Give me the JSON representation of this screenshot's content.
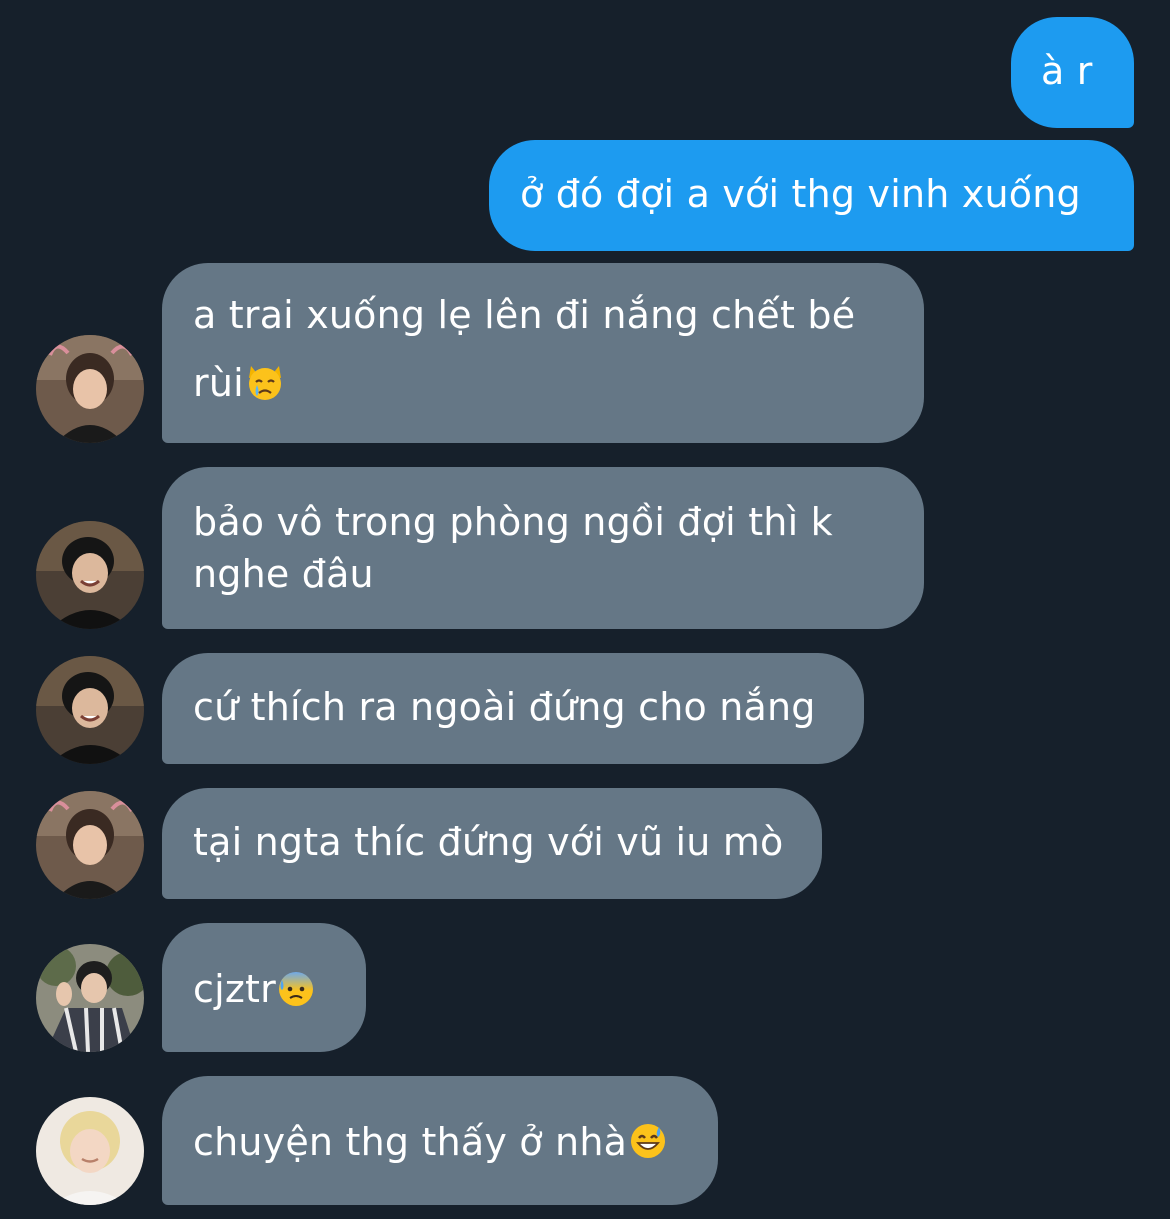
{
  "messages": [
    {
      "text": "à r"
    },
    {
      "text": "ở đó đợi a với thg vinh xuống"
    },
    {
      "line1": "a trai xuống lẹ lên đi nắng chết bé",
      "line2": "rùi",
      "emoji": "crying-cat-emoji"
    },
    {
      "line1": "bảo vô trong phòng ngồi đợi thì k",
      "line2": "nghe đâu"
    },
    {
      "text": "cứ thích ra ngoài đứng cho nắng"
    },
    {
      "text": "tại ngta thíc đứng với vũ iu mò"
    },
    {
      "text": "cjztr",
      "emoji": "anxious-face-with-sweat-emoji"
    },
    {
      "text": "chuyện thg thấy ở nhà",
      "emoji": "grinning-face-with-sweat-emoji"
    }
  ],
  "colors": {
    "background": "#16202b",
    "sent_bubble": "#1d9bf0",
    "received_bubble": "#657786",
    "text": "#ffffff"
  }
}
